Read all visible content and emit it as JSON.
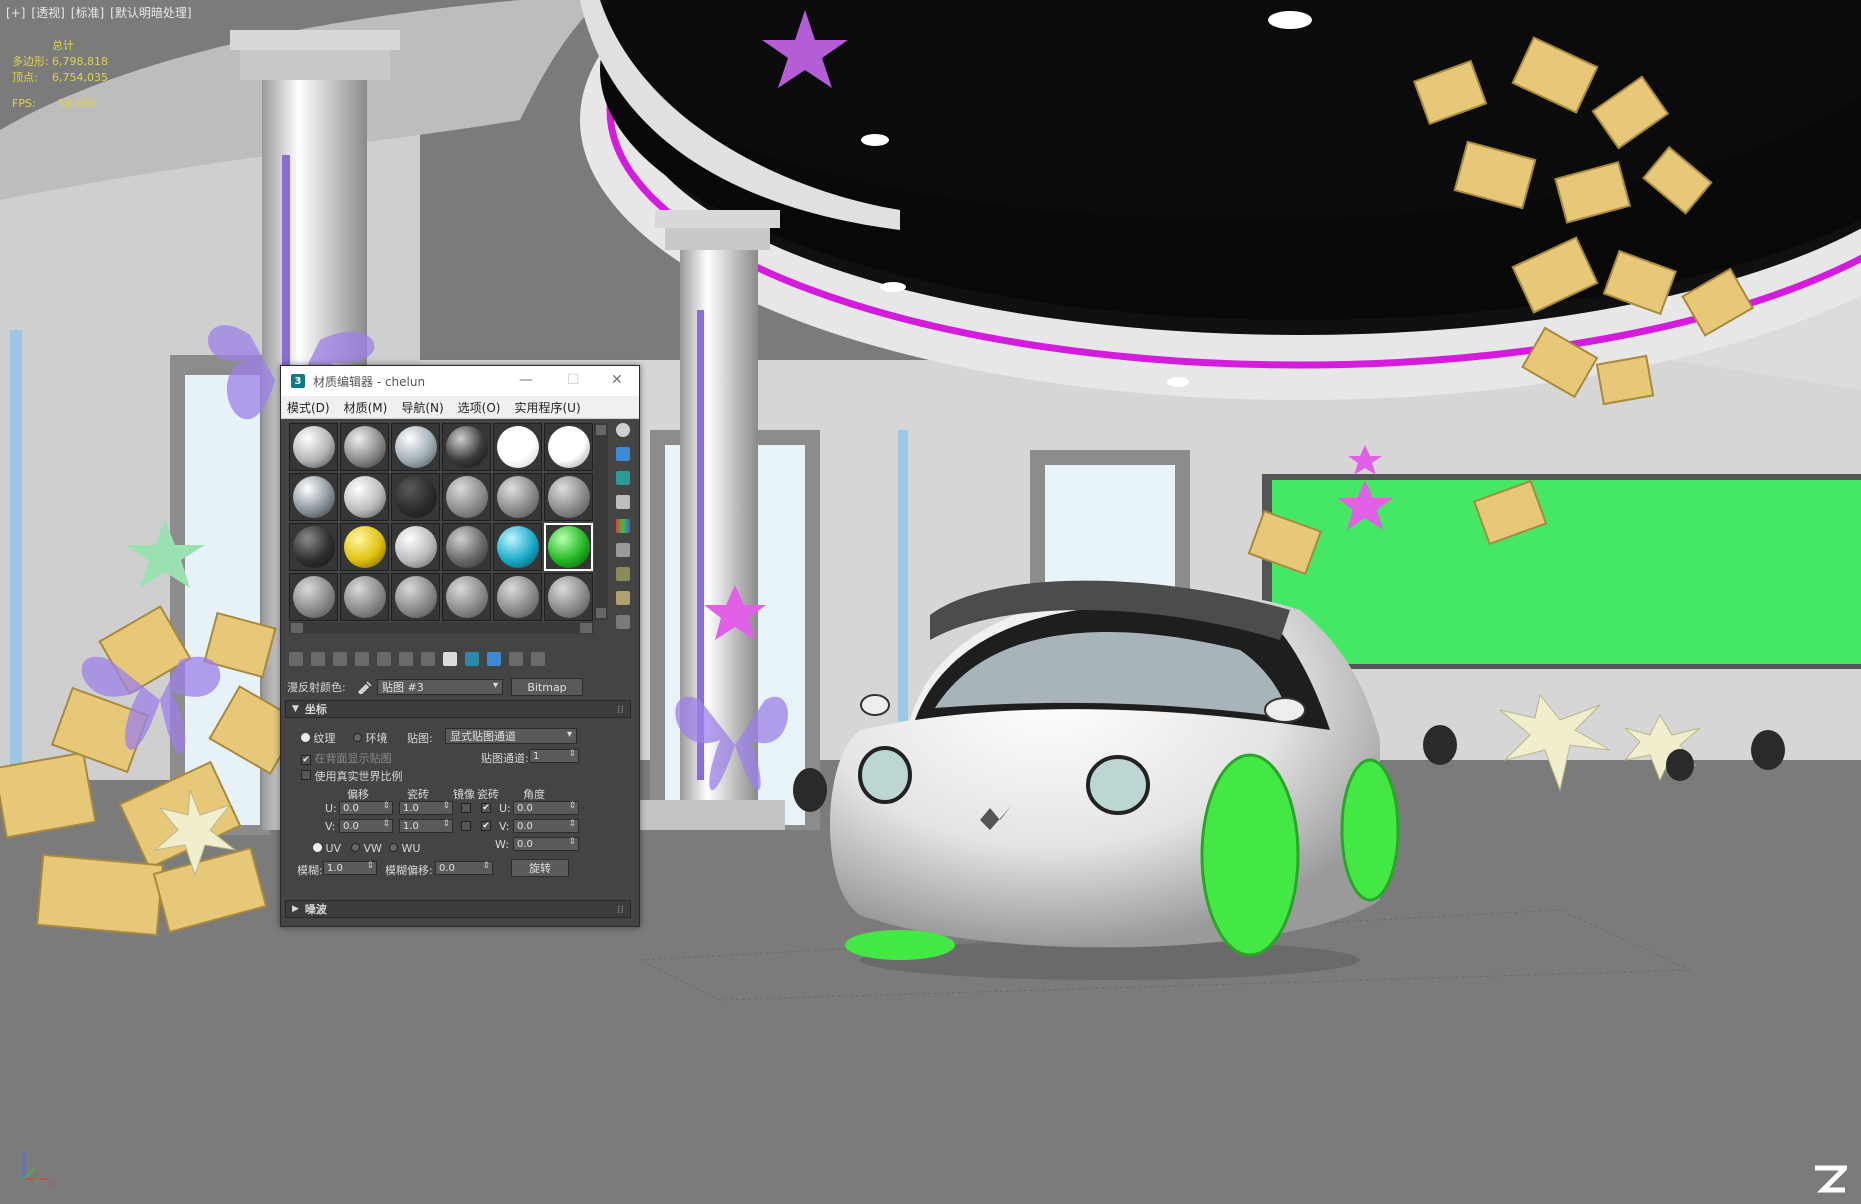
{
  "viewport": {
    "label": [
      "[+]",
      "[透视]",
      "[标准]",
      "[默认明暗处理]"
    ],
    "stats": {
      "total_label": "总计",
      "rows": [
        {
          "key": "多边形:",
          "value": "6,798,818"
        },
        {
          "key": "顶点:",
          "value": "6,754,035"
        }
      ],
      "fps_key": "FPS:",
      "fps_value": "58.686"
    },
    "axis": {
      "y": "y",
      "x": "x"
    }
  },
  "material_editor": {
    "logo": "3",
    "title": "材质编辑器 - chelun",
    "controls": {
      "minimize": "—",
      "maximize": "☐",
      "close": "✕"
    },
    "menu": [
      "模式(D)",
      "材质(M)",
      "导航(N)",
      "选项(O)",
      "实用程序(U)"
    ],
    "slots": [
      {
        "colors": [
          "#ffffff",
          "#b4b4b4",
          "#3e3e3e"
        ]
      },
      {
        "colors": [
          "#eeeeee",
          "#8a8a8a",
          "#2c2c2c"
        ]
      },
      {
        "colors": [
          "#ffffff",
          "#a2aeb6",
          "#3e464c"
        ]
      },
      {
        "colors": [
          "#cfcfcf",
          "#3a3a3a",
          "#0e0e0e"
        ]
      },
      {
        "colors": [
          "#ffffff",
          "#ffffff",
          "#c8c8c8"
        ]
      },
      {
        "colors": [
          "#ffffff",
          "#ffffff",
          "#8a8a8a"
        ]
      },
      {
        "colors": [
          "#ffffff",
          "#8a949c",
          "#2e3338"
        ]
      },
      {
        "colors": [
          "#ffffff",
          "#bcbcbc",
          "#4a4a4a"
        ]
      },
      {
        "colors": [
          "#5a5a5a",
          "#2c2c2c",
          "#141414"
        ]
      },
      {
        "colors": [
          "#dadada",
          "#8c8c8c",
          "#4a4a4a"
        ]
      },
      {
        "colors": [
          "#e0e0e0",
          "#8a8a8a",
          "#484848"
        ]
      },
      {
        "colors": [
          "#dedede",
          "#8a8a8a",
          "#484848"
        ]
      },
      {
        "colors": [
          "#8a8a8a",
          "#2e2e2e",
          "#121212"
        ]
      },
      {
        "colors": [
          "#fff8a0",
          "#e0c010",
          "#6a5200"
        ]
      },
      {
        "colors": [
          "#ffffff",
          "#bcbcbc",
          "#5a5a5a"
        ]
      },
      {
        "colors": [
          "#d0d0d0",
          "#6a6a6a",
          "#2a2a2a"
        ]
      },
      {
        "colors": [
          "#c0f4ff",
          "#1aaac8",
          "#0a4a5a"
        ]
      },
      {
        "colors": [
          "#b8ffb0",
          "#22b822",
          "#0a4a0a"
        ]
      },
      {
        "colors": [
          "#dadada",
          "#8a8a8a",
          "#484848"
        ]
      },
      {
        "colors": [
          "#dadada",
          "#8a8a8a",
          "#484848"
        ]
      },
      {
        "colors": [
          "#dadada",
          "#8a8a8a",
          "#484848"
        ]
      },
      {
        "colors": [
          "#dadada",
          "#8a8a8a",
          "#484848"
        ]
      },
      {
        "colors": [
          "#dadada",
          "#8a8a8a",
          "#484848"
        ]
      },
      {
        "colors": [
          "#dadada",
          "#8a8a8a",
          "#484848"
        ]
      }
    ],
    "selected_slot": 17,
    "map_row": {
      "label": "漫反射颜色:",
      "map_name": "贴图 #3",
      "map_type": "Bitmap"
    },
    "coordinates": {
      "header": "坐标",
      "texture": "纹理",
      "environment": "环境",
      "mapping_label": "贴图:",
      "mapping_value": "显式贴图通道",
      "show_on_back": "在背面显示贴图",
      "map_channel_label": "贴图通道:",
      "map_channel_value": "1",
      "real_world": "使用真实世界比例",
      "col_offset": "偏移",
      "col_tiling": "瓷砖",
      "col_mirror": "镜像",
      "col_tile": "瓷砖",
      "col_angle": "角度",
      "u_label": "U:",
      "v_label": "V:",
      "w_label": "W:",
      "u_offset": "0.0",
      "v_offset": "0.0",
      "u_tiling": "1.0",
      "v_tiling": "1.0",
      "u_angle": "0.0",
      "v_angle": "0.0",
      "w_angle": "0.0",
      "uv": "UV",
      "vw": "VW",
      "wu": "WU",
      "blur_label": "模糊:",
      "blur_value": "1.0",
      "blur_offset_label": "模糊偏移:",
      "blur_offset_value": "0.0",
      "rotate": "旋转"
    },
    "noise_header": "噪波"
  }
}
